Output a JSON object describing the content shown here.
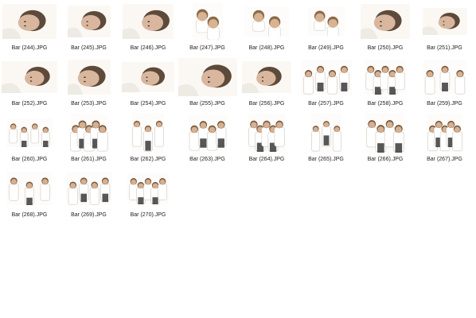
{
  "files": [
    {
      "name": "Bar (244).JPG",
      "photo": "portrait-photo"
    },
    {
      "name": "Bar (245).JPG",
      "photo": "portrait-photo"
    },
    {
      "name": "Bar (246).JPG",
      "photo": "portrait-photo"
    },
    {
      "name": "Bar (247).JPG",
      "photo": "two-children-photo"
    },
    {
      "name": "Bar (248).JPG",
      "photo": "two-children-photo"
    },
    {
      "name": "Bar (249).JPG",
      "photo": "two-children-photo"
    },
    {
      "name": "Bar (250).JPG",
      "photo": "portrait-photo"
    },
    {
      "name": "Bar (251).JPG",
      "photo": "portrait-photo"
    },
    {
      "name": "Bar (252).JPG",
      "photo": "portrait-photo"
    },
    {
      "name": "Bar (253).JPG",
      "photo": "portrait-photo"
    },
    {
      "name": "Bar (254).JPG",
      "photo": "portrait-photo"
    },
    {
      "name": "Bar (255).JPG",
      "photo": "portrait-photo"
    },
    {
      "name": "Bar (256).JPG",
      "photo": "portrait-photo"
    },
    {
      "name": "Bar (257).JPG",
      "photo": "group-photo"
    },
    {
      "name": "Bar (258).JPG",
      "photo": "group-photo"
    },
    {
      "name": "Bar (259).JPG",
      "photo": "group-photo"
    },
    {
      "name": "Bar (260).JPG",
      "photo": "group-photo"
    },
    {
      "name": "Bar (261).JPG",
      "photo": "group-photo"
    },
    {
      "name": "Bar (262).JPG",
      "photo": "group-photo"
    },
    {
      "name": "Bar (263).JPG",
      "photo": "group-photo"
    },
    {
      "name": "Bar (264).JPG",
      "photo": "group-photo"
    },
    {
      "name": "Bar (265).JPG",
      "photo": "group-photo"
    },
    {
      "name": "Bar (266).JPG",
      "photo": "group-photo"
    },
    {
      "name": "Bar (267).JPG",
      "photo": "group-photo"
    },
    {
      "name": "Bar (268).JPG",
      "photo": "group-photo"
    },
    {
      "name": "Bar (269).JPG",
      "photo": "group-photo"
    },
    {
      "name": "Bar (270).JPG",
      "photo": "group-photo"
    }
  ]
}
